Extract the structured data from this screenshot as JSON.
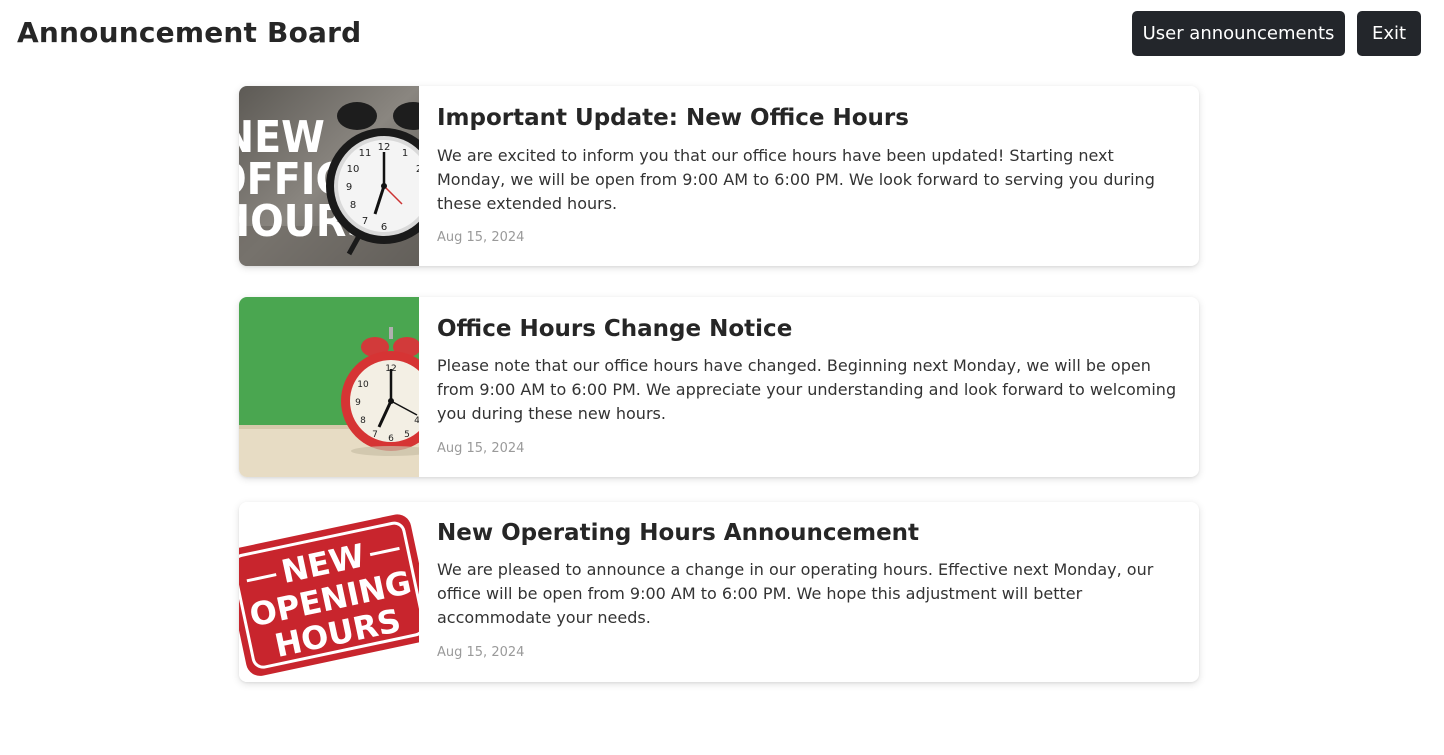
{
  "header": {
    "title": "Announcement Board",
    "user_announcements_label": "User announcements",
    "exit_label": "Exit"
  },
  "announcements": [
    {
      "title": "Important Update: New Office Hours",
      "text": "We are excited to inform you that our office hours have been updated! Starting next Monday, we will be open from 9:00 AM to 6:00 PM. We look forward to serving you during these extended hours.",
      "date": "Aug 15, 2024",
      "image_text": [
        "NEW",
        "OFFICE",
        "HOURS"
      ]
    },
    {
      "title": "Office Hours Change Notice",
      "text": "Please note that our office hours have changed. Beginning next Monday, we will be open from 9:00 AM to 6:00 PM. We appreciate your understanding and look forward to welcoming you during these new hours.",
      "date": "Aug 15, 2024"
    },
    {
      "title": "New Operating Hours Announcement",
      "text": "We are pleased to announce a change in our operating hours. Effective next Monday, our office will be open from 9:00 AM to 6:00 PM. We hope this adjustment will better accommodate your needs.",
      "date": "Aug 15, 2024",
      "image_text": [
        "NEW",
        "OPENING",
        "HOURS"
      ]
    }
  ],
  "colors": {
    "button_bg": "#23262b",
    "stamp_red": "#c8252d",
    "green_wall": "#4aa650"
  }
}
